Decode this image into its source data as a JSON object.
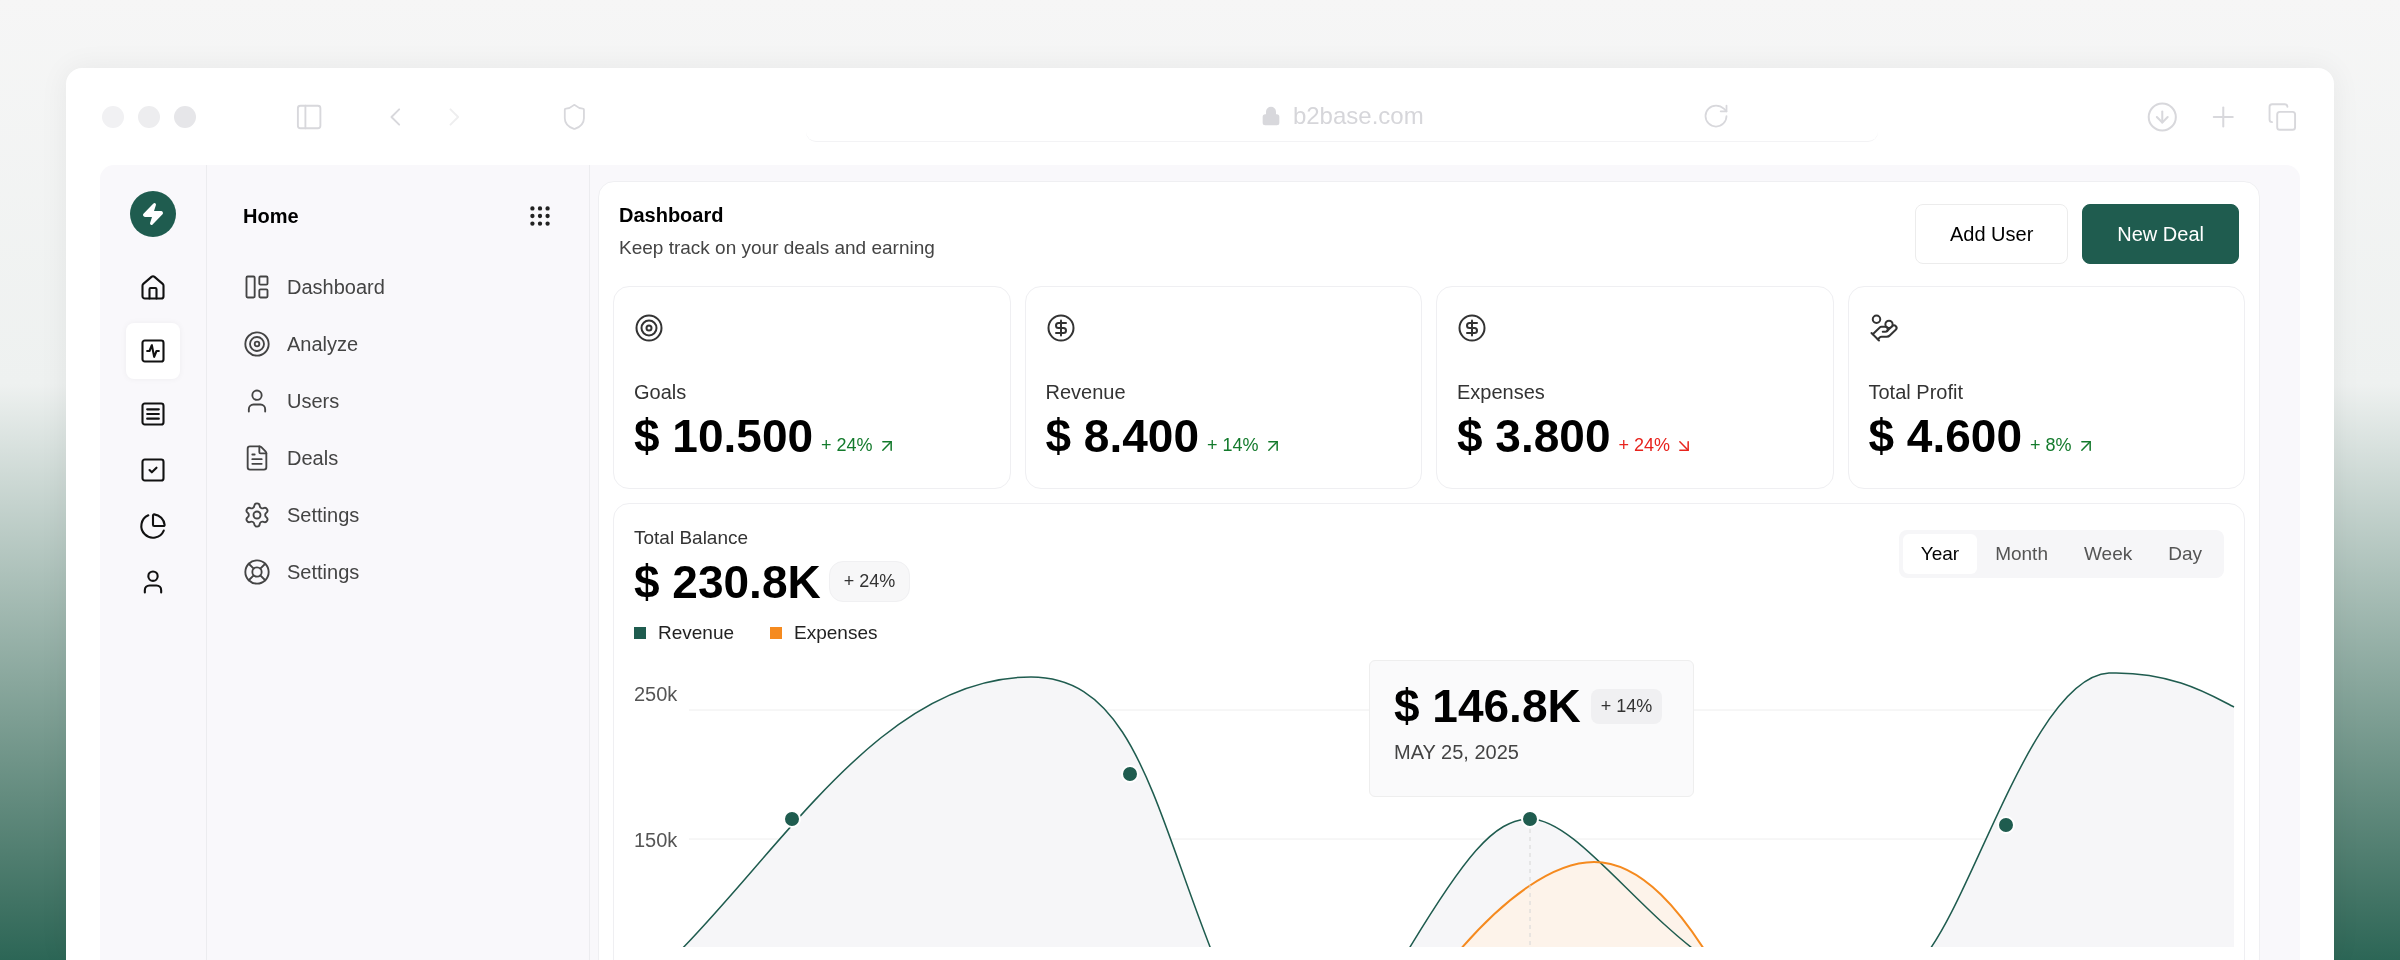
{
  "browser": {
    "url": "b2base.com"
  },
  "rail": [
    {
      "selected": false
    },
    {
      "selected": true
    },
    {
      "selected": false
    },
    {
      "selected": false
    },
    {
      "selected": false
    },
    {
      "selected": false
    }
  ],
  "sidebar": {
    "title": "Home",
    "items": [
      "Dashboard",
      "Analyze",
      "Users",
      "Deals",
      "Settings",
      "Settings"
    ]
  },
  "header": {
    "title": "Dashboard",
    "subtitle": "Keep track on your deals and earning",
    "buttons": [
      {
        "label": "Add User",
        "kind": "secondary"
      },
      {
        "label": "New Deal",
        "kind": "primary"
      }
    ]
  },
  "stats": [
    {
      "label": "Goals",
      "value": "$ 10.500",
      "change": "+ 24%",
      "rising": true
    },
    {
      "label": "Revenue",
      "value": "$ 8.400",
      "change": "+ 14%",
      "rising": true
    },
    {
      "label": "Expenses",
      "value": "$ 3.800",
      "change": "+ 24%",
      "rising": false
    },
    {
      "label": "Total Profit",
      "value": "$ 4.600",
      "change": "+ 8%",
      "rising": true
    }
  ],
  "balance": {
    "title": "Total Balance",
    "value": "$ 230.8K",
    "change": "+ 24%",
    "periods": [
      {
        "label": "Year",
        "selected": true
      },
      {
        "label": "Month",
        "selected": false
      },
      {
        "label": "Week",
        "selected": false
      },
      {
        "label": "Day",
        "selected": false
      }
    ],
    "legend": [
      {
        "label": "Revenue",
        "color": "#1f5c4f"
      },
      {
        "label": "Expenses",
        "color": "#f58a1f"
      }
    ],
    "y_labels": [
      "250k",
      "150k"
    ],
    "tooltip": {
      "value": "$ 146.8K",
      "change": "+ 14%",
      "date": "MAY 25, 2025"
    }
  }
}
